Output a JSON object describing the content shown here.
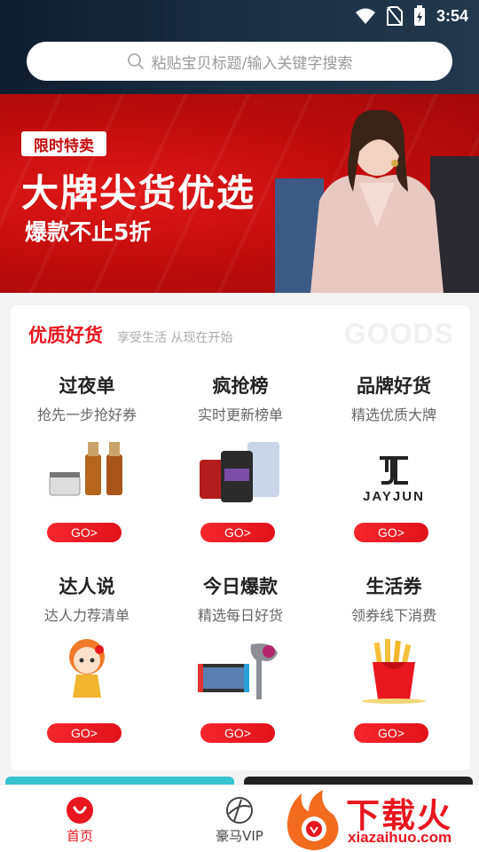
{
  "status_bar": {
    "time": "3:54",
    "icons": [
      "wifi-icon",
      "no-sim-icon",
      "battery-icon"
    ]
  },
  "search": {
    "placeholder": "粘贴宝贝标题/输入关键字搜索",
    "icon": "search-icon"
  },
  "banner": {
    "tag": "限时特卖",
    "title": "大牌尖货优选",
    "subtitle": "爆款不止5折"
  },
  "goods": {
    "title": "优质好货",
    "subtitle": "享受生活 从现在开始",
    "watermark": "GOODS",
    "items": [
      {
        "title": "过夜单",
        "sub": "抢先一步抢好券",
        "button": "GO>",
        "image": "skincare-bottles"
      },
      {
        "title": "疯抢榜",
        "sub": "实时更新榜单",
        "button": "GO>",
        "image": "protein-tubs"
      },
      {
        "title": "品牌好货",
        "sub": "精选优质大牌",
        "button": "GO>",
        "image": "jayjun-logo",
        "logo_text": "JAYJUN"
      },
      {
        "title": "达人说",
        "sub": "达人力荐清单",
        "button": "GO>",
        "image": "cartoon-girl"
      },
      {
        "title": "今日爆款",
        "sub": "精选每日好货",
        "button": "GO>",
        "image": "switch-dryer"
      },
      {
        "title": "生活券",
        "sub": "领券线下消费",
        "button": "GO>",
        "image": "fries"
      }
    ]
  },
  "tabbar": {
    "items": [
      {
        "label": "首页",
        "icon": "home-icon",
        "active": true
      },
      {
        "label": "豪马VIP",
        "icon": "vip-icon",
        "active": false
      }
    ],
    "active_color": "#e8161e"
  },
  "watermark": {
    "text": "下载火",
    "url": "xiazaihuo.com"
  },
  "colors": {
    "accent": "#e8161e",
    "banner": "#c40d0d",
    "header": "#1a2c3e"
  }
}
